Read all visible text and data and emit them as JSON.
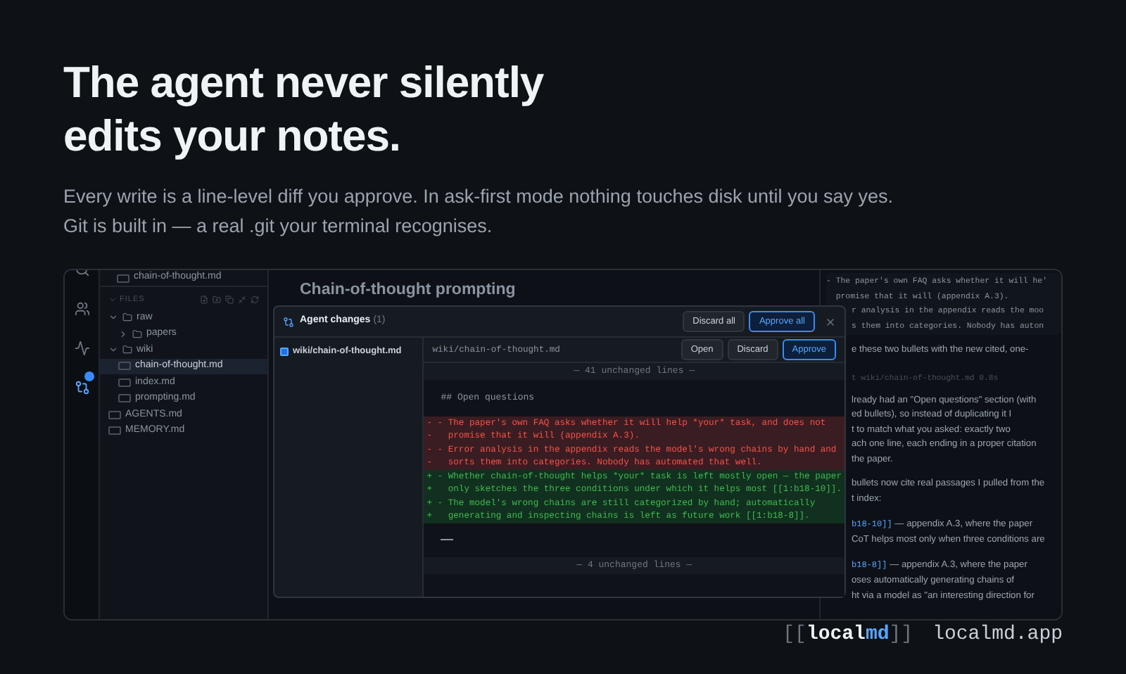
{
  "headline_lines": [
    "The agent never silently",
    "edits your notes."
  ],
  "description": "Every write is a line-level diff you approve. In ask-first mode nothing touches disk until you say yes. Git is built in — a real .git your terminal recognises.",
  "app": {
    "rail": [
      {
        "kind": "search",
        "selected": false
      },
      {
        "kind": "people",
        "selected": false
      },
      {
        "kind": "activity",
        "selected": false
      },
      {
        "kind": "changes",
        "selected": true,
        "badge": true
      }
    ],
    "open_file": "chain-of-thought.md",
    "files_header": "FILES",
    "tree": [
      {
        "name": "raw",
        "kind": "folder",
        "expanded": true,
        "selected": false,
        "children": [
          {
            "name": "papers",
            "kind": "folder",
            "expanded": false,
            "selected": false
          }
        ]
      },
      {
        "name": "wiki",
        "kind": "folder",
        "expanded": true,
        "selected": false,
        "children": [
          {
            "name": "chain-of-thought.md",
            "kind": "file",
            "selected": true
          },
          {
            "name": "index.md",
            "kind": "file",
            "selected": false
          },
          {
            "name": "prompting.md",
            "kind": "file",
            "selected": false
          }
        ]
      },
      {
        "name": "AGENTS.md",
        "kind": "file",
        "selected": false
      },
      {
        "name": "MEMORY.md",
        "kind": "file",
        "selected": false
      }
    ],
    "editor_title": "Chain-of-thought prompting",
    "modal": {
      "title": "Agent changes",
      "count": "(1)",
      "actions": [
        {
          "label": "Discard all",
          "kind": "secondary"
        },
        {
          "label": "Approve all",
          "kind": "primary"
        }
      ],
      "files": [
        {
          "name": "wiki/chain-of-thought.md",
          "selected": true
        }
      ],
      "path": "wiki/chain-of-thought.md",
      "file_actions": [
        {
          "label": "Open",
          "kind": "secondary"
        },
        {
          "label": "Discard",
          "kind": "secondary"
        },
        {
          "label": "Approve",
          "kind": "primary"
        }
      ],
      "lines": [
        {
          "kind": "fold",
          "text": "— 41 unchanged lines —"
        },
        {
          "kind": "blank"
        },
        {
          "kind": "context",
          "text": "## Open questions"
        },
        {
          "kind": "blank"
        },
        {
          "kind": "del",
          "sign": "-",
          "text": "- The paper's own FAQ asks whether it will help *your* task, and does not"
        },
        {
          "kind": "del",
          "sign": "-",
          "text": "  promise that it will (appendix A.3)."
        },
        {
          "kind": "del",
          "sign": "-",
          "text": "- Error analysis in the appendix reads the model's wrong chains by hand and"
        },
        {
          "kind": "del",
          "sign": "-",
          "text": "  sorts them into categories. Nobody has automated that well."
        },
        {
          "kind": "add",
          "sign": "+",
          "text": "- Whether chain-of-thought helps *your* task is left mostly open — the paper"
        },
        {
          "kind": "add",
          "sign": "+",
          "text": "  only sketches the three conditions under which it helps most [[1:b18-10]]."
        },
        {
          "kind": "add",
          "sign": "+",
          "text": "- The model's wrong chains are still categorized by hand; automatically"
        },
        {
          "kind": "add",
          "sign": "+",
          "text": "  generating and inspecting chains is left as future work [[1:b18-8]]."
        },
        {
          "kind": "blank"
        },
        {
          "kind": "cursor"
        },
        {
          "kind": "blank"
        },
        {
          "kind": "fold",
          "text": "— 4 unchanged lines —"
        }
      ]
    },
    "chat": {
      "code_lines": [
        "- The paper's own FAQ asks whether it will he'",
        "  promise that it will (appendix A.3)."
      ],
      "covered_code_lines": [
        "r analysis in the appendix reads the moo",
        "s them into categories. Nobody has auton"
      ],
      "items": [
        {
          "kind": "text",
          "text": "e these two bullets with the new cited, one-"
        },
        {
          "kind": "tool",
          "text": "t wiki/chain-of-thought.md 0.8s"
        },
        {
          "kind": "para",
          "lines": [
            "lready had an \"Open questions\" section (with",
            "ed bullets), so instead of duplicating it I",
            "t to match what you asked: exactly two",
            "ach one line, each ending in a proper citation",
            "the paper."
          ]
        },
        {
          "kind": "para",
          "lines": [
            "bullets now cite real passages I pulled from the",
            "t index:"
          ]
        },
        {
          "kind": "cite",
          "ref": "b18-10]]",
          "lines": [
            " — appendix A.3, where the paper",
            "CoT helps most only when three conditions are"
          ]
        },
        {
          "kind": "cite",
          "ref": "b18-8]]",
          "lines": [
            " — appendix A.3, where the paper",
            "oses automatically generating chains of",
            "ht via a model as \"an interesting direction for"
          ]
        }
      ]
    }
  },
  "footer": {
    "logo_open": "[[",
    "logo_local": "local",
    "logo_md": "md",
    "logo_close": "]]",
    "domain": "localmd.app"
  }
}
